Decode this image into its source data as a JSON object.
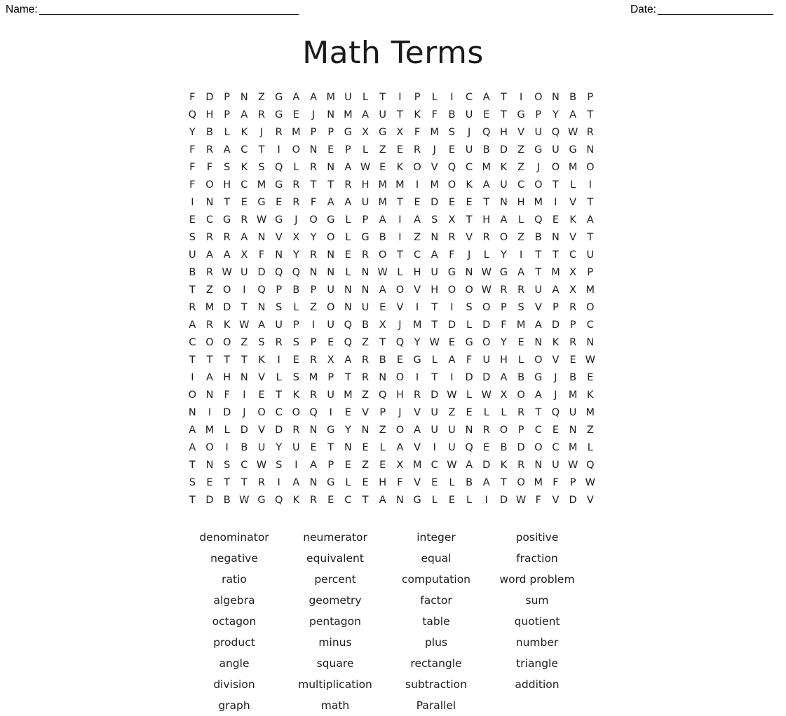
{
  "header": {
    "name_label": "Name:",
    "name_rule": "_____________________________________________",
    "date_label": "Date:",
    "date_rule": "____________________"
  },
  "title": "Math Terms",
  "grid": {
    "rows": 24,
    "cols": 24,
    "letters": [
      [
        "F",
        "D",
        "P",
        "N",
        "Z",
        "G",
        "A",
        "A",
        "M",
        "U",
        "L",
        "T",
        "I",
        "P",
        "L",
        "I",
        "C",
        "A",
        "T",
        "I",
        "O",
        "N",
        "B",
        "P"
      ],
      [
        "Q",
        "H",
        "P",
        "A",
        "R",
        "G",
        "E",
        "J",
        "N",
        "M",
        "A",
        "U",
        "T",
        "K",
        "F",
        "B",
        "U",
        "E",
        "T",
        "G",
        "P",
        "Y",
        "A",
        "T"
      ],
      [
        "Y",
        "B",
        "L",
        "K",
        "J",
        "R",
        "M",
        "P",
        "P",
        "G",
        "X",
        "G",
        "X",
        "F",
        "M",
        "S",
        "J",
        "Q",
        "H",
        "V",
        "U",
        "Q",
        "W",
        "R"
      ],
      [
        "F",
        "R",
        "A",
        "C",
        "T",
        "I",
        "O",
        "N",
        "E",
        "P",
        "L",
        "Z",
        "E",
        "R",
        "J",
        "E",
        "U",
        "B",
        "D",
        "Z",
        "G",
        "U",
        "G",
        "N"
      ],
      [
        "F",
        "F",
        "S",
        "K",
        "S",
        "Q",
        "L",
        "R",
        "N",
        "A",
        "W",
        "E",
        "K",
        "O",
        "V",
        "Q",
        "C",
        "M",
        "K",
        "Z",
        "J",
        "O",
        "M",
        "O"
      ],
      [
        "F",
        "O",
        "H",
        "C",
        "M",
        "G",
        "R",
        "T",
        "T",
        "R",
        "H",
        "M",
        "M",
        "I",
        "M",
        "O",
        "K",
        "A",
        "U",
        "C",
        "O",
        "T",
        "L",
        "I"
      ],
      [
        "I",
        "N",
        "T",
        "E",
        "G",
        "E",
        "R",
        "F",
        "A",
        "A",
        "U",
        "M",
        "T",
        "E",
        "D",
        "E",
        "E",
        "T",
        "N",
        "H",
        "M",
        "I",
        "V",
        "T"
      ],
      [
        "E",
        "C",
        "G",
        "R",
        "W",
        "G",
        "J",
        "O",
        "G",
        "L",
        "P",
        "A",
        "I",
        "A",
        "S",
        "X",
        "T",
        "H",
        "A",
        "L",
        "Q",
        "E",
        "K",
        "A"
      ],
      [
        "S",
        "R",
        "R",
        "A",
        "N",
        "V",
        "X",
        "Y",
        "O",
        "L",
        "G",
        "B",
        "I",
        "Z",
        "N",
        "R",
        "V",
        "R",
        "O",
        "Z",
        "B",
        "N",
        "V",
        "T"
      ],
      [
        "U",
        "A",
        "A",
        "X",
        "F",
        "N",
        "Y",
        "R",
        "N",
        "E",
        "R",
        "O",
        "T",
        "C",
        "A",
        "F",
        "J",
        "L",
        "Y",
        "I",
        "T",
        "T",
        "C",
        "U"
      ],
      [
        "B",
        "R",
        "W",
        "U",
        "D",
        "Q",
        "Q",
        "N",
        "N",
        "L",
        "N",
        "W",
        "L",
        "H",
        "U",
        "G",
        "N",
        "W",
        "G",
        "A",
        "T",
        "M",
        "X",
        "P"
      ],
      [
        "T",
        "Z",
        "O",
        "I",
        "Q",
        "P",
        "B",
        "P",
        "U",
        "N",
        "N",
        "A",
        "O",
        "V",
        "H",
        "O",
        "O",
        "W",
        "R",
        "R",
        "U",
        "A",
        "X",
        "M"
      ],
      [
        "R",
        "M",
        "D",
        "T",
        "N",
        "S",
        "L",
        "Z",
        "O",
        "N",
        "U",
        "E",
        "V",
        "I",
        "T",
        "I",
        "S",
        "O",
        "P",
        "S",
        "V",
        "P",
        "R",
        "O"
      ],
      [
        "A",
        "R",
        "K",
        "W",
        "A",
        "U",
        "P",
        "I",
        "U",
        "Q",
        "B",
        "X",
        "J",
        "M",
        "T",
        "D",
        "L",
        "D",
        "F",
        "M",
        "A",
        "D",
        "P",
        "C"
      ],
      [
        "C",
        "O",
        "O",
        "Z",
        "S",
        "R",
        "S",
        "P",
        "E",
        "Q",
        "Z",
        "T",
        "Q",
        "Y",
        "W",
        "E",
        "G",
        "O",
        "Y",
        "E",
        "N",
        "K",
        "R",
        "N"
      ],
      [
        "T",
        "T",
        "T",
        "T",
        "K",
        "I",
        "E",
        "R",
        "X",
        "A",
        "R",
        "B",
        "E",
        "G",
        "L",
        "A",
        "F",
        "U",
        "H",
        "L",
        "O",
        "V",
        "E",
        "W"
      ],
      [
        "I",
        "A",
        "H",
        "N",
        "V",
        "L",
        "S",
        "M",
        "P",
        "T",
        "R",
        "N",
        "O",
        "I",
        "T",
        "I",
        "D",
        "D",
        "A",
        "B",
        "G",
        "J",
        "B",
        "E"
      ],
      [
        "O",
        "N",
        "F",
        "I",
        "E",
        "T",
        "K",
        "R",
        "U",
        "M",
        "Z",
        "Q",
        "H",
        "R",
        "D",
        "W",
        "L",
        "W",
        "X",
        "O",
        "A",
        "J",
        "M",
        "K"
      ],
      [
        "N",
        "I",
        "D",
        "J",
        "O",
        "C",
        "O",
        "Q",
        "I",
        "E",
        "V",
        "P",
        "J",
        "V",
        "U",
        "Z",
        "E",
        "L",
        "L",
        "R",
        "T",
        "Q",
        "U",
        "M"
      ],
      [
        "A",
        "M",
        "L",
        "D",
        "V",
        "D",
        "R",
        "N",
        "G",
        "Y",
        "N",
        "Z",
        "O",
        "A",
        "U",
        "U",
        "N",
        "R",
        "O",
        "P",
        "C",
        "E",
        "N",
        "Z"
      ],
      [
        "A",
        "O",
        "I",
        "B",
        "U",
        "Y",
        "U",
        "E",
        "T",
        "N",
        "E",
        "L",
        "A",
        "V",
        "I",
        "U",
        "Q",
        "E",
        "B",
        "D",
        "O",
        "C",
        "M",
        "L"
      ],
      [
        "T",
        "N",
        "S",
        "C",
        "W",
        "S",
        "I",
        "A",
        "P",
        "E",
        "Z",
        "E",
        "X",
        "M",
        "C",
        "W",
        "A",
        "D",
        "K",
        "R",
        "N",
        "U",
        "W",
        "Q"
      ],
      [
        "S",
        "E",
        "T",
        "T",
        "R",
        "I",
        "A",
        "N",
        "G",
        "L",
        "E",
        "H",
        "F",
        "V",
        "E",
        "L",
        "B",
        "A",
        "T",
        "O",
        "M",
        "F",
        "P",
        "W"
      ],
      [
        "T",
        "D",
        "B",
        "W",
        "G",
        "Q",
        "K",
        "R",
        "E",
        "C",
        "T",
        "A",
        "N",
        "G",
        "L",
        "E",
        "L",
        "I",
        "D",
        "W",
        "F",
        "V",
        "D",
        "V"
      ]
    ]
  },
  "word_list": {
    "columns": 4,
    "rows": [
      [
        "denominator",
        "neumerator",
        "integer",
        "positive"
      ],
      [
        "negative",
        "equivalent",
        "equal",
        "fraction"
      ],
      [
        "ratio",
        "percent",
        "computation",
        "word problem"
      ],
      [
        "algebra",
        "geometry",
        "factor",
        "sum"
      ],
      [
        "octagon",
        "pentagon",
        "table",
        "quotient"
      ],
      [
        "product",
        "minus",
        "plus",
        "number"
      ],
      [
        "angle",
        "square",
        "rectangle",
        "triangle"
      ],
      [
        "division",
        "multiplication",
        "subtraction",
        "addition"
      ],
      [
        "graph",
        "math",
        "Parallel",
        ""
      ]
    ]
  }
}
